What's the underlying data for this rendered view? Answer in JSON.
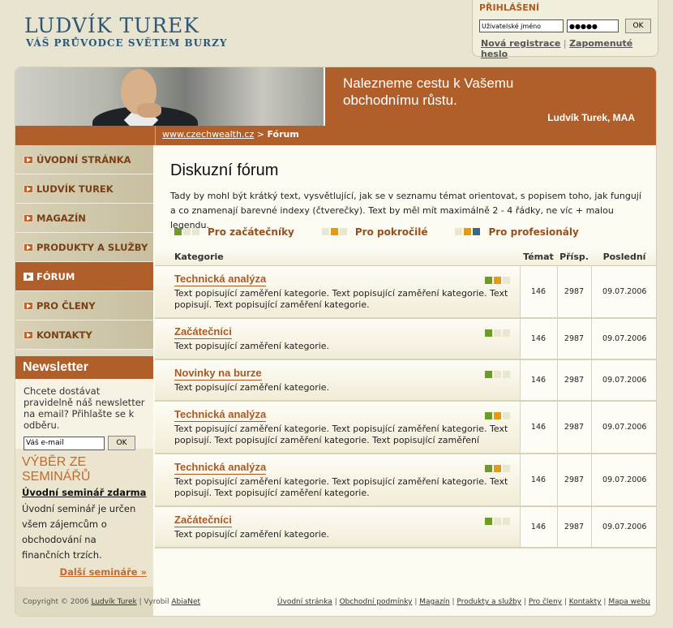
{
  "header": {
    "logo_title": "LUDVÍK TUREK",
    "logo_subtitle": "VÁŠ PRŮVODCE SVĚTEM BURZY"
  },
  "login": {
    "title": "PŘIHLÁŠENÍ",
    "username_value": "Uživatelské jméno",
    "password_value": "●●●●●",
    "ok_label": "OK",
    "register_label": "Nová registrace",
    "separator": "|",
    "forgot_label": "Zapomenuté heslo"
  },
  "banner": {
    "slogan_line1": "Nalezneme cestu k Vašemu",
    "slogan_line2": "obchodnímu růstu.",
    "author": "Ludvík Turek, MAA"
  },
  "breadcrumb": {
    "home": "www.czechwealth.cz",
    "separator": ">",
    "current": "Fórum"
  },
  "nav": {
    "items": [
      {
        "label": "ÚVODNÍ STRÁNKA",
        "active": false
      },
      {
        "label": "LUDVÍK TUREK",
        "active": false
      },
      {
        "label": "MAGAZÍN",
        "active": false
      },
      {
        "label": "PRODUKTY A SLUŽBY",
        "active": false
      },
      {
        "label": "FÓRUM",
        "active": true
      },
      {
        "label": "PRO ČLENY",
        "active": false
      },
      {
        "label": "KONTAKTY",
        "active": false
      }
    ]
  },
  "newsletter": {
    "heading": "Newsletter",
    "text": "Chcete dostávat pravidelně náš newsletter na email? Přihlašte se k odběru.",
    "email_value": "Váš e-mail",
    "ok_label": "OK"
  },
  "seminars": {
    "heading_line1": "VÝBĚR ZE",
    "heading_line2": "SEMINÁŘŮ",
    "link": "Úvodní seminář zdarma",
    "text": "Úvodní seminář je určen všem zájemcům o obchodování na finančních trzích.",
    "more": "Další semináře »"
  },
  "content": {
    "title": "Diskuzní fórum",
    "intro": "Tady by mohl být krátký text, vysvětlující, jak se v seznamu témat orientovat, s popisem toho, jak fungují a co znamenají barevné indexy (čtverečky). Text by měl mít maximálně 2 - 4 řádky, ne víc + malou legendu.",
    "legend": [
      {
        "label": "Pro začátečníky",
        "levels": [
          "green",
          "empty",
          "empty"
        ]
      },
      {
        "label": "Pro pokročilé",
        "levels": [
          "empty",
          "orange",
          "empty"
        ]
      },
      {
        "label": "Pro profesionály",
        "levels": [
          "empty",
          "orange",
          "blue"
        ]
      }
    ]
  },
  "table": {
    "headers": {
      "category": "Kategorie",
      "topics": "Témat",
      "posts": "Přísp.",
      "last": "Poslední"
    },
    "rows": [
      {
        "name": "Technická analýza",
        "desc": "Text popisující zaměření kategorie. Text popisující zaměření kategorie. Text popisují. Text popisující zaměření kategorie.",
        "levels": [
          "green",
          "orange",
          "empty"
        ],
        "topics": "146",
        "posts": "2987",
        "last": "09.07.2006"
      },
      {
        "name": "Začátečníci",
        "desc": "Text popisující zaměření kategorie.",
        "levels": [
          "green",
          "empty",
          "empty"
        ],
        "topics": "146",
        "posts": "2987",
        "last": "09.07.2006"
      },
      {
        "name": "Novinky na burze",
        "desc": "Text popisující zaměření kategorie.",
        "levels": [
          "green",
          "empty",
          "empty"
        ],
        "topics": "146",
        "posts": "2987",
        "last": "09.07.2006"
      },
      {
        "name": "Technická analýza",
        "desc": "Text popisující zaměření kategorie. Text popisující zaměření kategorie. Text popisují. Text popisující zaměření kategorie. Text popisující zaměření",
        "levels": [
          "green",
          "orange",
          "empty"
        ],
        "topics": "146",
        "posts": "2987",
        "last": "09.07.2006"
      },
      {
        "name": "Technická analýza",
        "desc": "Text popisující zaměření kategorie. Text popisující zaměření kategorie. Text popisují. Text popisující zaměření kategorie.",
        "levels": [
          "green",
          "orange",
          "empty"
        ],
        "topics": "146",
        "posts": "2987",
        "last": "09.07.2006"
      },
      {
        "name": "Začátečníci",
        "desc": "Text popisující zaměření kategorie.",
        "levels": [
          "green",
          "empty",
          "empty"
        ],
        "topics": "146",
        "posts": "2987",
        "last": "09.07.2006"
      }
    ]
  },
  "footer": {
    "copyright": "Copyright © 2006",
    "owner_link": "Ludvík Turek",
    "made_by": "| Vyrobil",
    "maker_link": "AbiaNet",
    "links": [
      "Úvodní stránka",
      "Obchodní podmínky",
      "Magazín",
      "Produkty a služby",
      "Pro členy",
      "Kontakty",
      "Mapa webu"
    ]
  },
  "colors": {
    "accent": "#b05f2b",
    "logo": "#2f5774",
    "level_green": "#6e9a2a",
    "level_orange": "#e39b16",
    "level_blue": "#3b6785"
  }
}
